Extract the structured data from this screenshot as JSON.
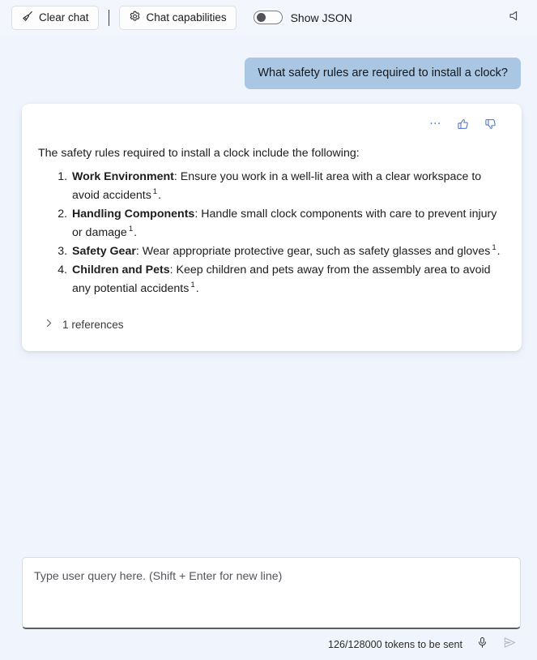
{
  "toolbar": {
    "clear_chat_label": "Clear chat",
    "clear_chat_icon": "broom-icon",
    "chat_capabilities_label": "Chat capabilities",
    "chat_capabilities_icon": "gear-icon",
    "show_json_label": "Show JSON",
    "show_json_toggle_state": "off",
    "speaker_icon": "speaker-mute-icon"
  },
  "conversation": {
    "user_message": "What safety rules are required to install a clock?",
    "assistant": {
      "actions": {
        "more_label": "…",
        "more_icon": "ellipsis-icon",
        "thumbs_up_icon": "thumbs-up-icon",
        "thumbs_down_icon": "thumbs-down-icon",
        "accent_color": "#4d6fc4"
      },
      "intro": "The safety rules required to install a clock include the following:",
      "items": [
        {
          "term": "Work Environment",
          "separator": ": ",
          "text": "Ensure you work in a well-lit area with a clear workspace to avoid accidents",
          "ref": "1",
          "tail": "."
        },
        {
          "term": "Handling Components",
          "separator": ": ",
          "text": "Handle small clock components with care to prevent injury or damage",
          "ref": "1",
          "tail": "."
        },
        {
          "term": "Safety Gear",
          "separator": ": ",
          "text": "Wear appropriate protective gear, such as safety glasses and gloves",
          "ref": "1",
          "tail": "."
        },
        {
          "term": "Children and Pets",
          "separator": ": ",
          "text": "Keep children and pets away from the assembly area to avoid any potential accidents",
          "ref": "1",
          "tail": "."
        }
      ],
      "references_label": "1 references",
      "references_expanded": false,
      "references_chevron_icon": "chevron-right-icon"
    }
  },
  "composer": {
    "placeholder": "Type user query here. (Shift + Enter for new line)",
    "value": "",
    "token_count": "126/128000 tokens to be sent",
    "mic_icon": "microphone-icon",
    "send_icon": "send-icon"
  },
  "colors": {
    "page_background": "#f0f4fc",
    "toolbar_background": "#f4f6fd",
    "user_bubble": "#a9c6e3",
    "card_background": "#ffffff",
    "accent": "#4d6fc4"
  }
}
